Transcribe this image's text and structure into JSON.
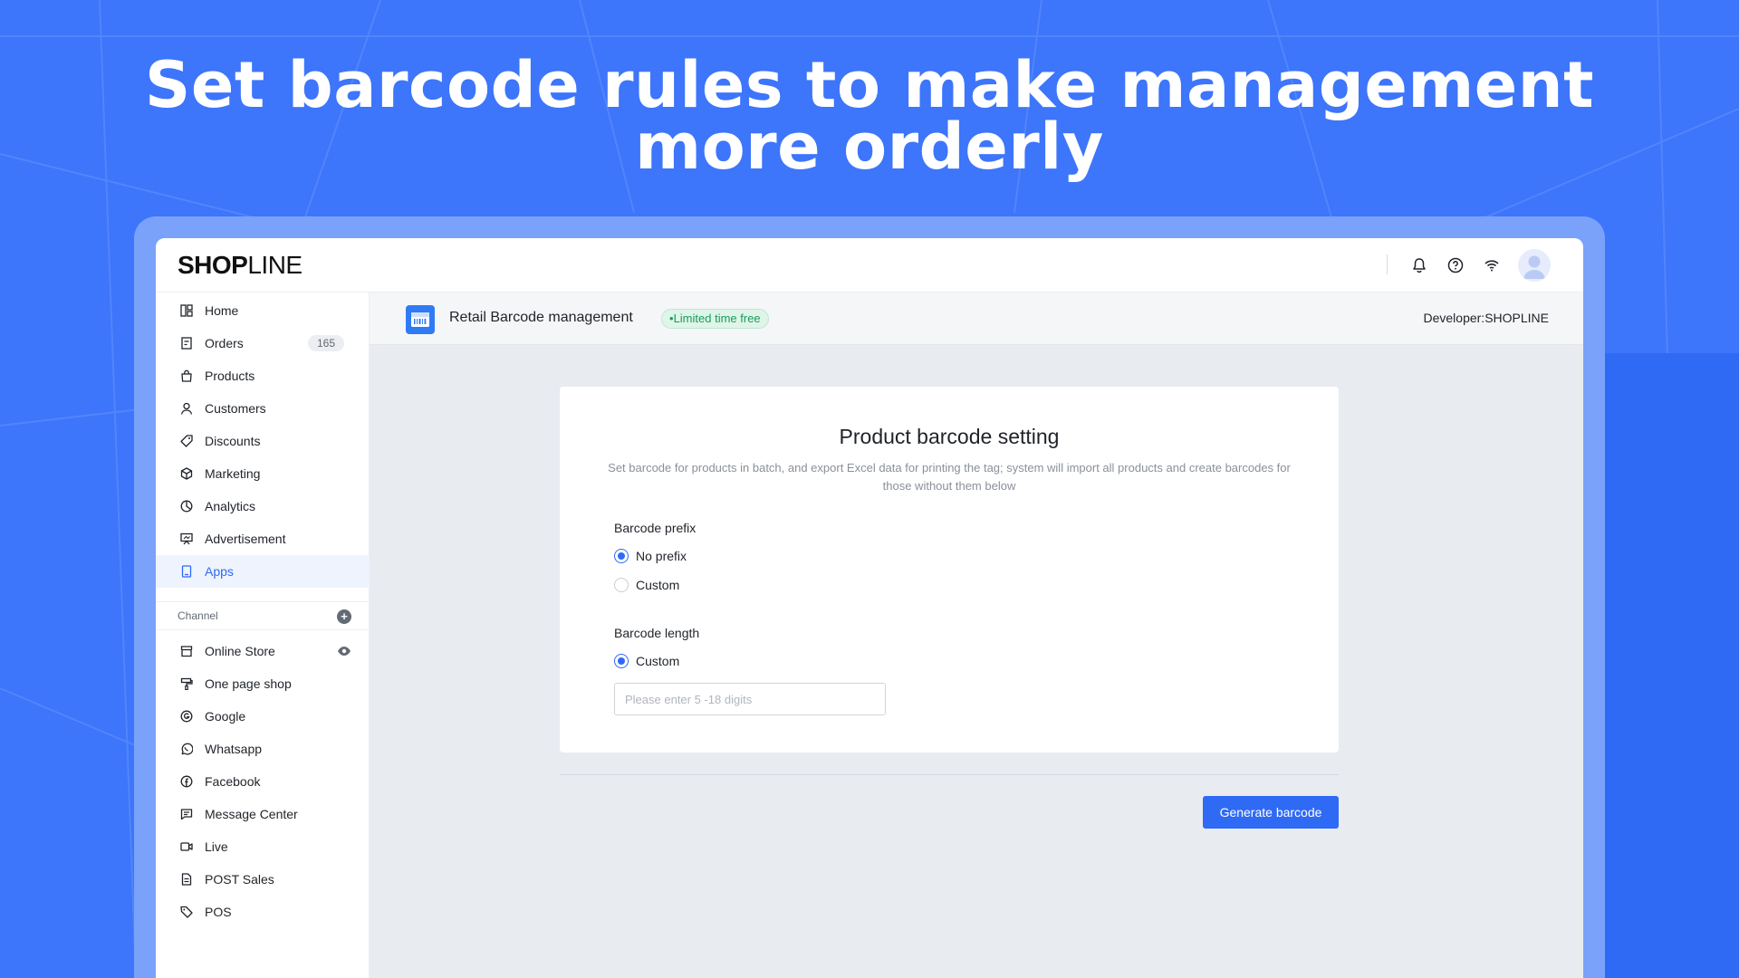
{
  "headline": {
    "line1": "Set barcode rules to make management",
    "line2": "more orderly"
  },
  "colors": {
    "background": "#3d75fb",
    "primary": "#2f6af5",
    "tag_green": "#1a9a5c"
  },
  "topbar": {
    "logo_bold": "SHOP",
    "logo_thin": "LINE",
    "icons": [
      "bell-icon",
      "help-icon",
      "wifi-icon",
      "avatar"
    ]
  },
  "sidebar": {
    "items": [
      {
        "label": "Home",
        "icon": "home-icon"
      },
      {
        "label": "Orders",
        "icon": "orders-icon",
        "badge": "165"
      },
      {
        "label": "Products",
        "icon": "bag-icon"
      },
      {
        "label": "Customers",
        "icon": "user-icon"
      },
      {
        "label": "Discounts",
        "icon": "tag-icon"
      },
      {
        "label": "Marketing",
        "icon": "cube-icon"
      },
      {
        "label": "Analytics",
        "icon": "pie-icon"
      },
      {
        "label": "Advertisement",
        "icon": "billboard-icon"
      },
      {
        "label": "Apps",
        "icon": "apps-icon",
        "active": true
      }
    ],
    "channel_label": "Channel",
    "channels": [
      {
        "label": "Online Store",
        "icon": "store-icon"
      },
      {
        "label": "One page shop",
        "icon": "brush-icon"
      },
      {
        "label": "Google",
        "icon": "google-icon"
      },
      {
        "label": "Whatsapp",
        "icon": "whatsapp-icon"
      },
      {
        "label": "Facebook",
        "icon": "facebook-icon"
      },
      {
        "label": "Message Center",
        "icon": "message-icon"
      },
      {
        "label": "Live",
        "icon": "video-icon"
      },
      {
        "label": "POST Sales",
        "icon": "document-icon"
      },
      {
        "label": "POS",
        "icon": "price-tag-icon"
      }
    ]
  },
  "appbar": {
    "title": "Retail Barcode management",
    "tag": "Limited time free",
    "developer": "Developer:SHOPLINE"
  },
  "card": {
    "title": "Product barcode setting",
    "description": "Set barcode for products in batch, and export Excel data for printing the tag; system will import all products and create barcodes for those without them below",
    "prefix_label": "Barcode prefix",
    "prefix_options": [
      {
        "label": "No prefix",
        "checked": true
      },
      {
        "label": "Custom",
        "checked": false
      }
    ],
    "length_label": "Barcode length",
    "length_options": [
      {
        "label": "Custom",
        "checked": true
      }
    ],
    "length_input": {
      "value": "",
      "placeholder": "Please enter 5 -18 digits"
    }
  },
  "actions": {
    "generate_label": "Generate barcode"
  }
}
